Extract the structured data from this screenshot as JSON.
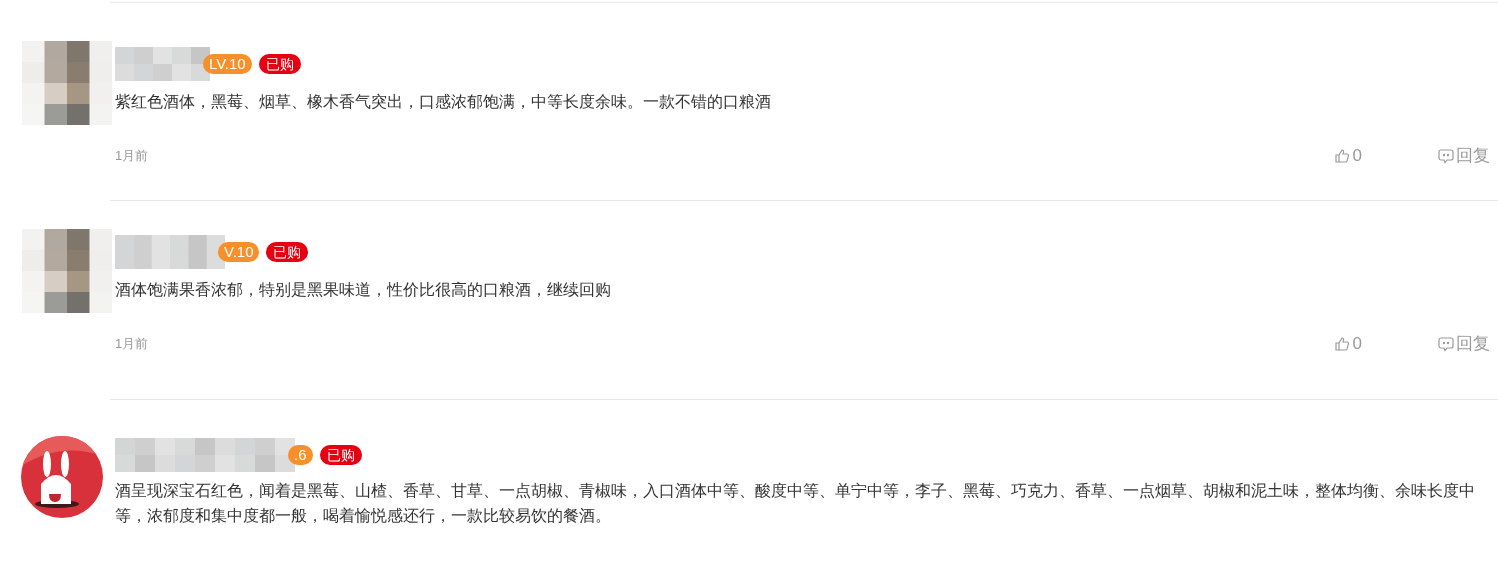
{
  "comments": [
    {
      "avatar": {
        "kind": "mosaic"
      },
      "level": "LV.10",
      "badge": "已购",
      "text": "紫红色酒体，黑莓、烟草、橡木香气突出，口感浓郁饱满，中等长度余味。一款不错的口粮酒",
      "time": "1月前",
      "likes": "0",
      "reply": "回复"
    },
    {
      "avatar": {
        "kind": "mosaic"
      },
      "level": "V.10",
      "badge": "已购",
      "text": "酒体饱满果香浓郁，特别是黑果味道，性价比很高的口粮酒，继续回购",
      "time": "1月前",
      "likes": "0",
      "reply": "回复"
    },
    {
      "level": ".6",
      "badge": "已购",
      "text": "酒呈现深宝石红色，闻着是黑莓、山楂、香草、甘草、一点胡椒、青椒味，入口酒体中等、酸度中等、单宁中等，李子、黑莓、巧克力、香草、一点烟草、胡椒和泥土味，整体均衡、余味长度中等，浓郁度和集中度都一般，喝着愉悦感还行，一款比较易饮的餐酒。"
    }
  ]
}
